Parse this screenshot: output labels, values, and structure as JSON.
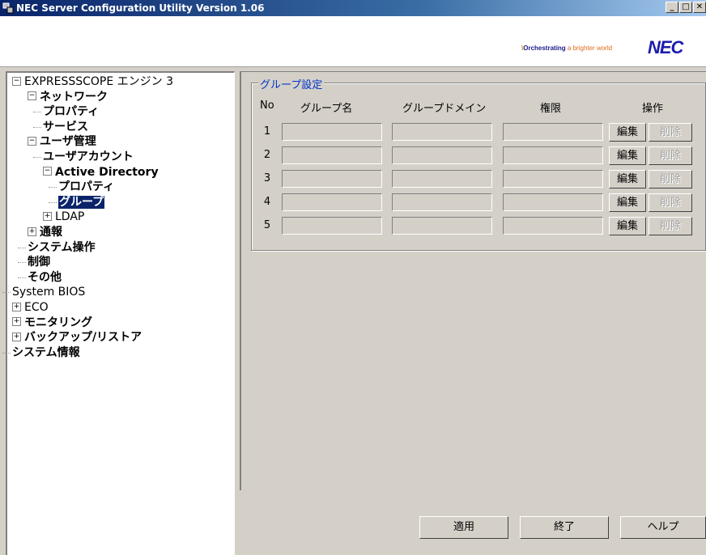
{
  "window": {
    "title": "NEC Server Configuration Utility Version 1.06",
    "buttons": [
      "_",
      "□",
      "✕"
    ]
  },
  "banner": {
    "tagline_slash": "\\",
    "tagline_part1": "Orchestrating",
    "tagline_part2": " a brighter world",
    "logo": "NEC"
  },
  "tree": [
    {
      "id": "root",
      "label": "EXPRESSSCOPE エンジン 3",
      "expander": "−",
      "bold": false
    },
    {
      "id": "network",
      "label": "ネットワーク",
      "expander": "−",
      "bold": true
    },
    {
      "id": "network-property",
      "label": "プロパティ",
      "bold": true
    },
    {
      "id": "network-service",
      "label": "サービス",
      "bold": true
    },
    {
      "id": "user-mgmt",
      "label": "ユーザ管理",
      "expander": "−",
      "bold": true
    },
    {
      "id": "user-account",
      "label": "ユーザアカウント",
      "bold": true
    },
    {
      "id": "active-directory",
      "label": "Active Directory",
      "expander": "−",
      "bold": true
    },
    {
      "id": "ad-property",
      "label": "プロパティ",
      "bold": true
    },
    {
      "id": "ad-group",
      "label": "グループ",
      "bold": true,
      "selected": true
    },
    {
      "id": "ldap",
      "label": "LDAP",
      "expander": "+",
      "bold": false
    },
    {
      "id": "notify",
      "label": "通報",
      "expander": "+",
      "bold": true
    },
    {
      "id": "system-op",
      "label": "システム操作",
      "bold": true
    },
    {
      "id": "control",
      "label": "制御",
      "bold": true
    },
    {
      "id": "other",
      "label": "その他",
      "bold": true
    },
    {
      "id": "system-bios",
      "label": "System BIOS",
      "bold": false
    },
    {
      "id": "eco",
      "label": "ECO",
      "expander": "+",
      "bold": false
    },
    {
      "id": "monitoring",
      "label": "モニタリング",
      "expander": "+",
      "bold": true
    },
    {
      "id": "backup",
      "label": "バックアップ/リストア",
      "expander": "+",
      "bold": true
    },
    {
      "id": "sysinfo",
      "label": "システム情報",
      "bold": true
    }
  ],
  "group": {
    "title": "グループ設定",
    "headers": {
      "no": "No",
      "name": "グループ名",
      "domain": "グループドメイン",
      "privilege": "権限",
      "operation": "操作"
    },
    "rows": [
      {
        "no": "1",
        "name": "",
        "domain": "",
        "privilege": "",
        "edit": "編集",
        "delete": "削除"
      },
      {
        "no": "2",
        "name": "",
        "domain": "",
        "privilege": "",
        "edit": "編集",
        "delete": "削除"
      },
      {
        "no": "3",
        "name": "",
        "domain": "",
        "privilege": "",
        "edit": "編集",
        "delete": "削除"
      },
      {
        "no": "4",
        "name": "",
        "domain": "",
        "privilege": "",
        "edit": "編集",
        "delete": "削除"
      },
      {
        "no": "5",
        "name": "",
        "domain": "",
        "privilege": "",
        "edit": "編集",
        "delete": "削除"
      }
    ]
  },
  "footer": {
    "apply": "適用",
    "exit": "終了",
    "help": "ヘルプ"
  },
  "colors": {
    "titlebar": "#0a246a",
    "groupbox_title": "#0033cc",
    "selection": "#0a246a",
    "logo": "#1b1bb0"
  }
}
